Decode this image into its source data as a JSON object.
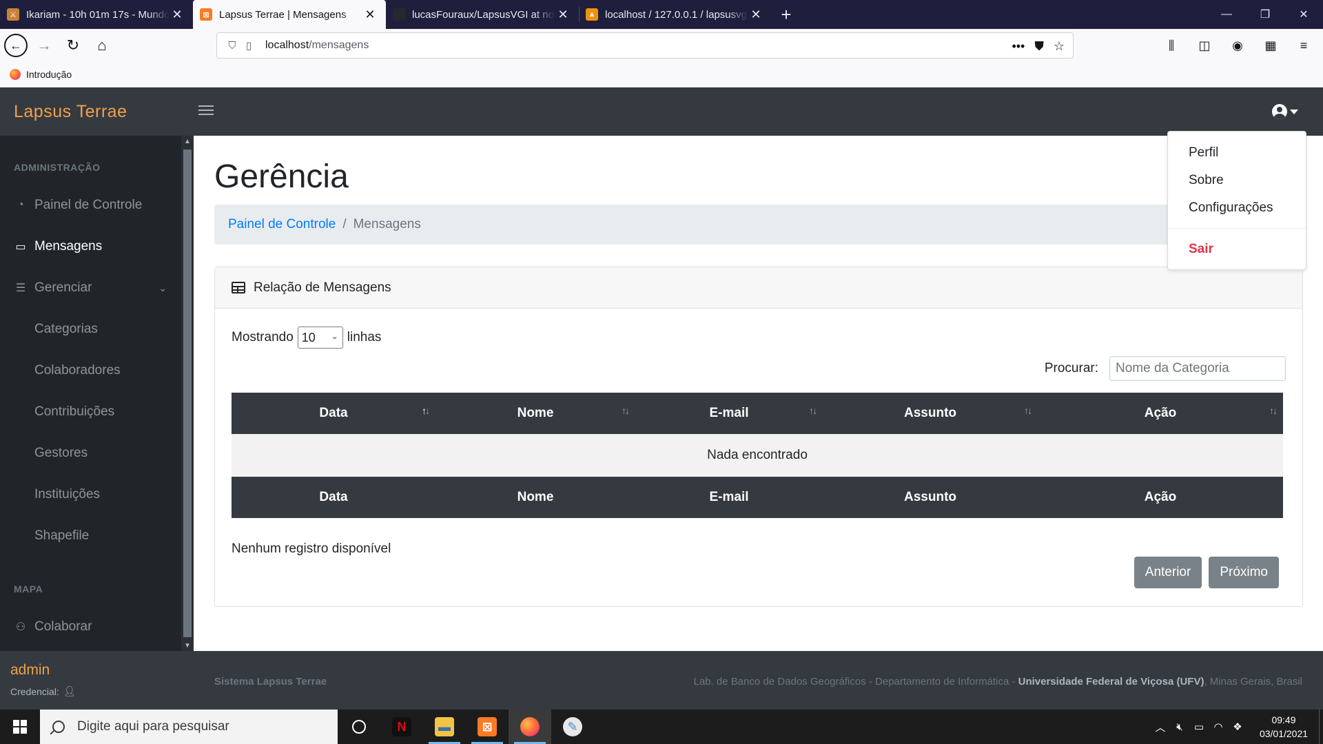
{
  "browser": {
    "tabs": [
      {
        "title": "Ikariam - 10h 01m 17s - Mundo",
        "active": false,
        "favicon_color": "#c8823a"
      },
      {
        "title": "Lapsus Terrae | Mensagens",
        "active": true,
        "favicon_color": "#fb7a24"
      },
      {
        "title": "lucasFouraux/LapsusVGI at nov",
        "active": false,
        "favicon_color": "#24292e"
      },
      {
        "title": "localhost / 127.0.0.1 / lapsusvgi",
        "active": false,
        "favicon_color": "#f29111"
      }
    ],
    "url_host": "localhost",
    "url_path": "/mensagens",
    "bookmark": "Introdução"
  },
  "app": {
    "brand": "Lapsus Terrae",
    "sidebar": {
      "heading_admin": "ADMINISTRAÇÃO",
      "painel": "Painel de Controle",
      "mensagens": "Mensagens",
      "gerenciar": "Gerenciar",
      "sub_items": [
        "Categorias",
        "Colaboradores",
        "Contribuições",
        "Gestores",
        "Instituições",
        "Shapefile"
      ],
      "heading_mapa": "MAPA",
      "colaborar": "Colaborar",
      "user": "admin",
      "credencial": "Credencial:"
    },
    "page_title": "Gerência",
    "breadcrumb": {
      "link": "Painel de Controle",
      "current": "Mensagens"
    },
    "card": {
      "title": "Relação de Mensagens",
      "length_prefix": "Mostrando",
      "length_value": "10",
      "length_suffix": "linhas",
      "search_label": "Procurar:",
      "search_placeholder": "Nome da Categoria",
      "columns": [
        "Data",
        "Nome",
        "E-mail",
        "Assunto",
        "Ação"
      ],
      "empty": "Nada encontrado",
      "info": "Nenhum registro disponível",
      "prev": "Anterior",
      "next": "Próximo"
    },
    "footer": {
      "left": "Sistema Lapsus Terrae",
      "right_prefix": "Lab. de Banco de Dados Geográficos - Departamento de Informática - ",
      "right_bold": "Universidade Federal de Viçosa (UFV)",
      "right_suffix": ", Minas Gerais, Brasil"
    },
    "user_menu": {
      "items": [
        "Perfil",
        "Sobre",
        "Configurações"
      ],
      "logout": "Sair"
    }
  },
  "taskbar": {
    "search_placeholder": "Digite aqui para pesquisar",
    "time": "09:49",
    "date": "03/01/2021"
  },
  "colors": {
    "brand": "#f0a04b",
    "topbar": "#343a40",
    "sidebar": "#212529",
    "link": "#007bff",
    "danger": "#dc3545"
  }
}
